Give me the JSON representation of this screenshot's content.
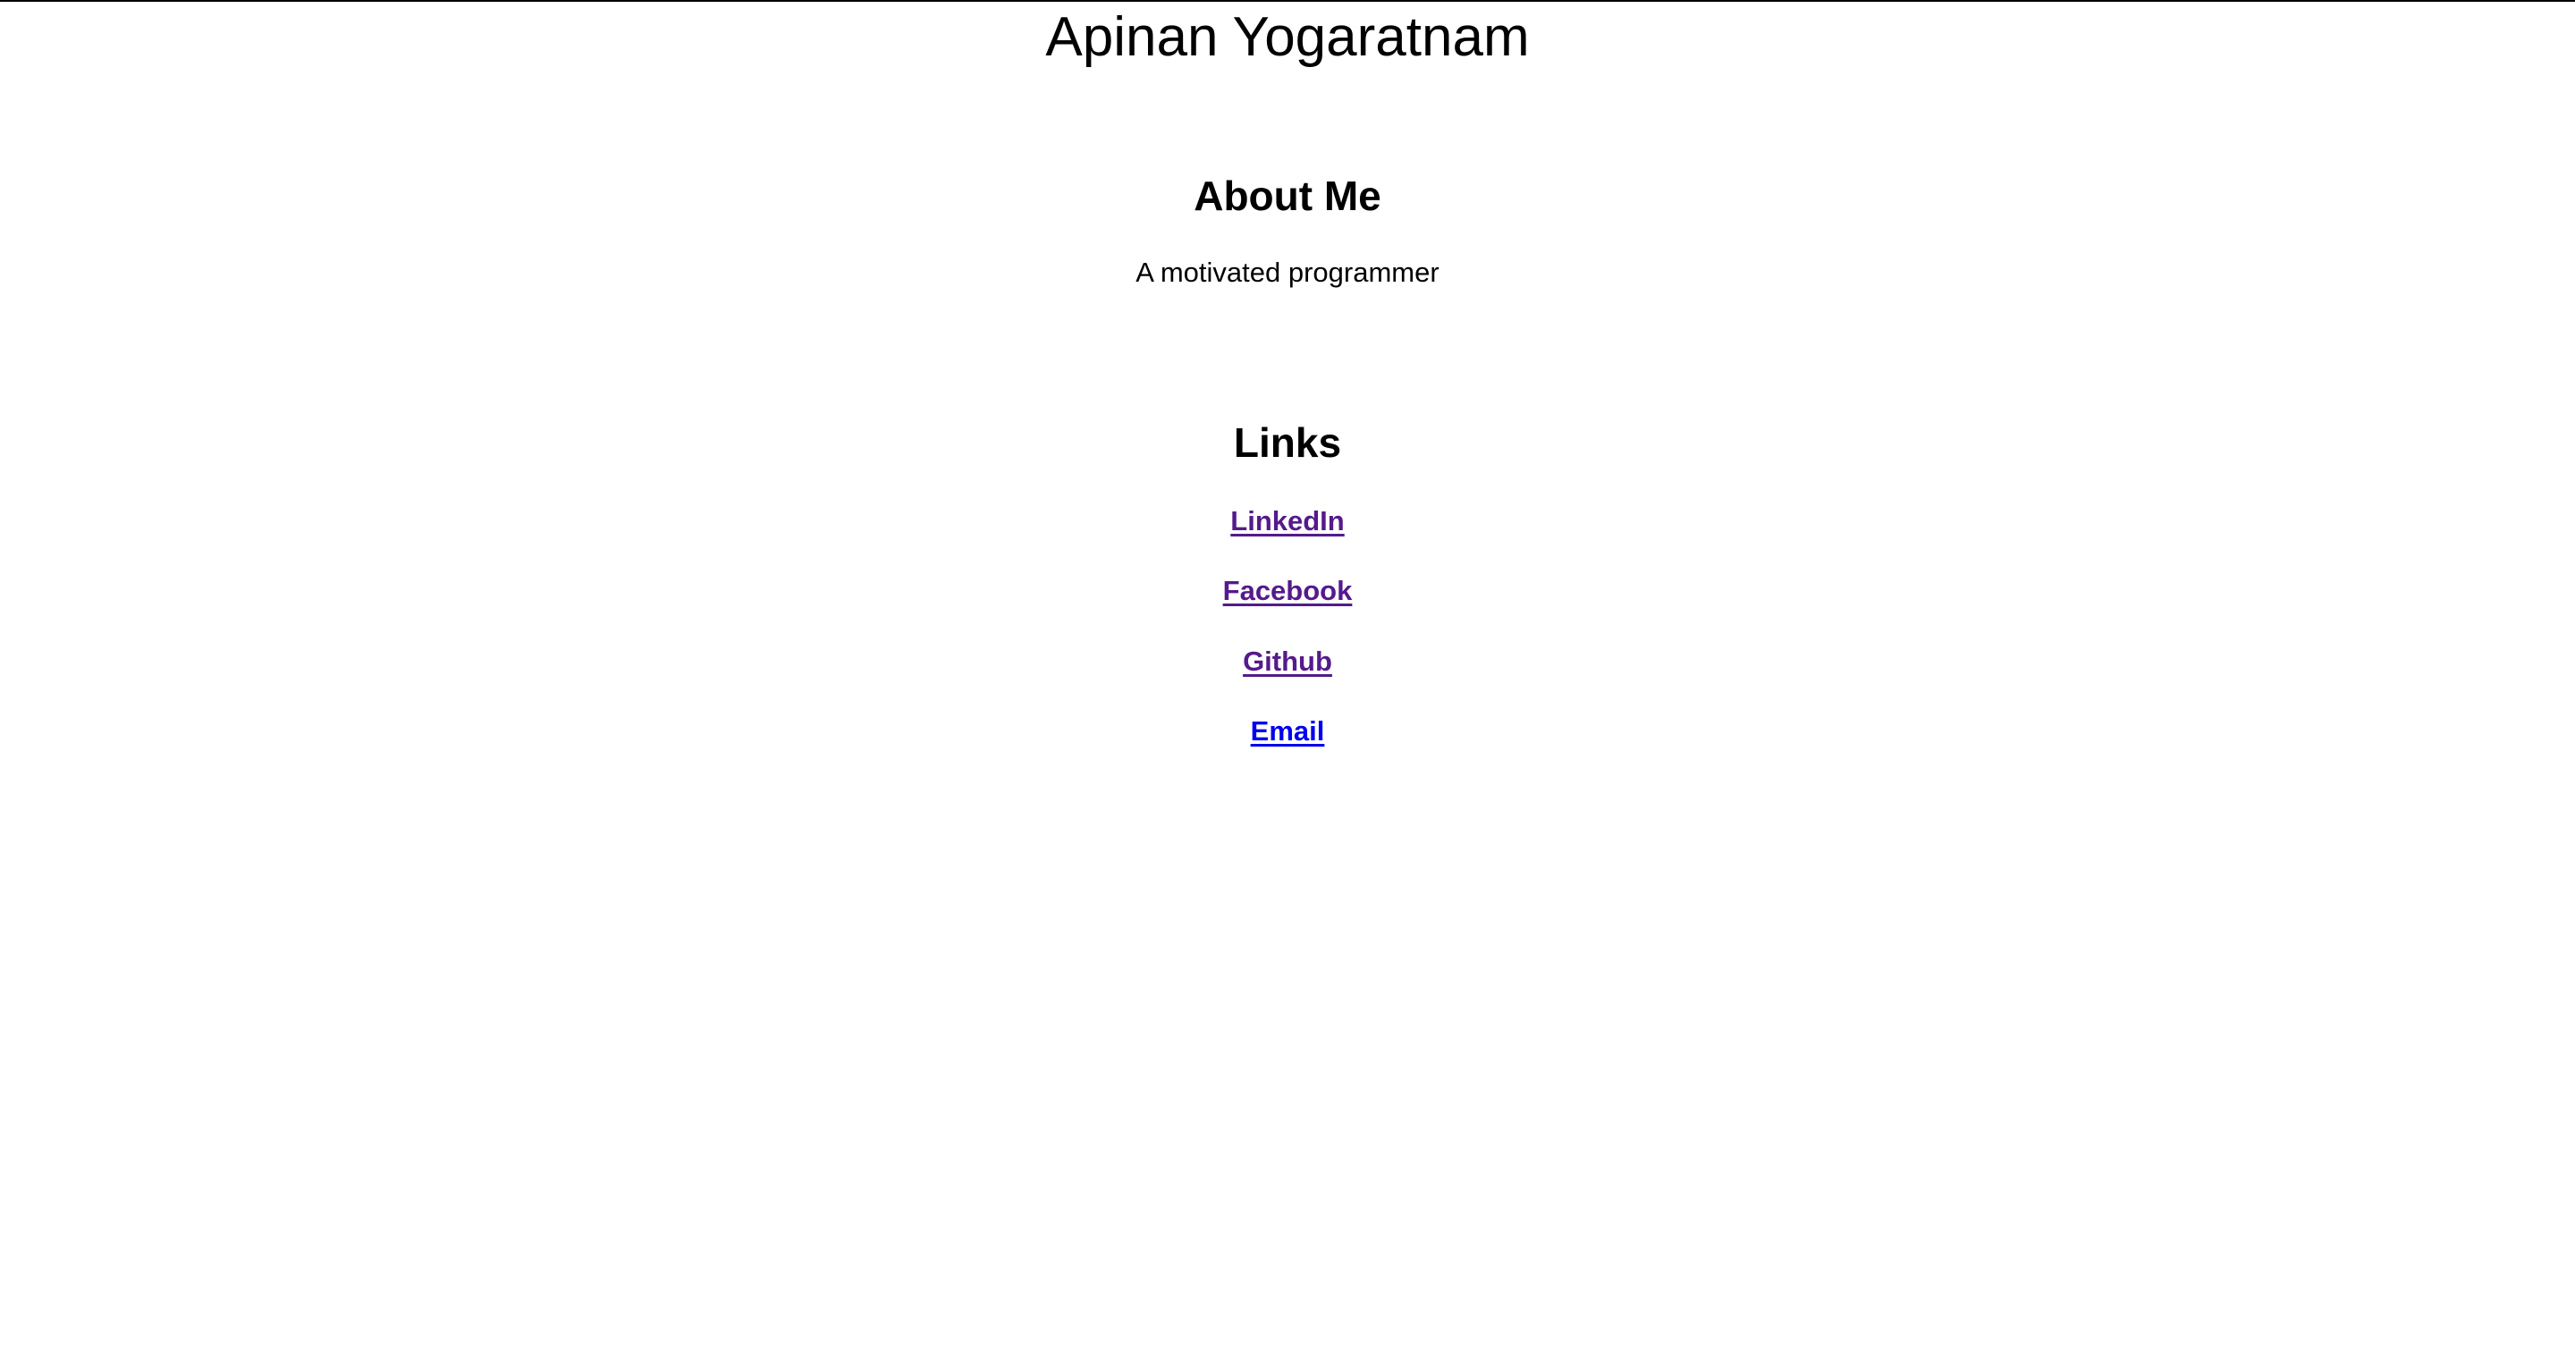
{
  "header": {
    "title": "Apinan Yogaratnam"
  },
  "about": {
    "heading": "About Me",
    "text": "A motivated programmer"
  },
  "links": {
    "heading": "Links",
    "items": [
      {
        "label": "LinkedIn",
        "color": "#551a8b"
      },
      {
        "label": "Facebook",
        "color": "#551a8b"
      },
      {
        "label": "Github",
        "color": "#551a8b"
      },
      {
        "label": "Email",
        "color": "#0000ee"
      }
    ]
  }
}
